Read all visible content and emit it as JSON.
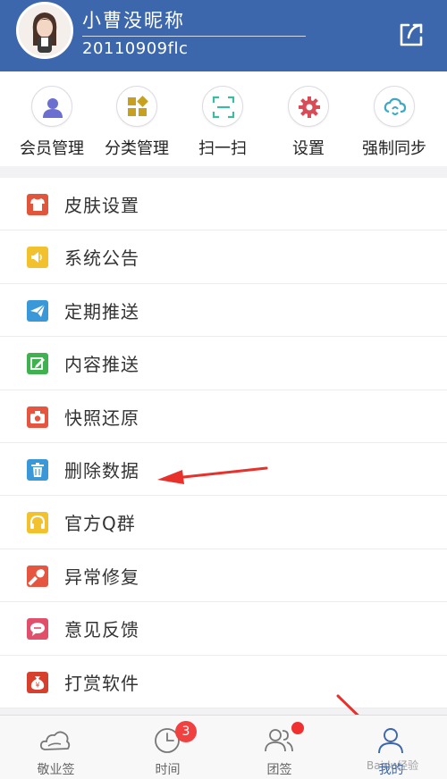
{
  "header": {
    "username": "小曹没昵称",
    "user_id": "20110909flc",
    "accent_color": "#3c67ad"
  },
  "quick_actions": [
    {
      "label": "会员管理",
      "icon": "member-icon"
    },
    {
      "label": "分类管理",
      "icon": "category-icon"
    },
    {
      "label": "扫一扫",
      "icon": "scan-icon"
    },
    {
      "label": "设置",
      "icon": "gear-icon"
    },
    {
      "label": "强制同步",
      "icon": "sync-icon"
    }
  ],
  "menu": [
    {
      "label": "皮肤设置",
      "icon": "shirt-icon",
      "color": "#e2553d"
    },
    {
      "label": "系统公告",
      "icon": "speaker-icon",
      "color": "#f2c12e"
    },
    {
      "label": "定期推送",
      "icon": "paper-plane-icon",
      "color": "#3a98d8"
    },
    {
      "label": "内容推送",
      "icon": "edit-icon",
      "color": "#3fb14e"
    },
    {
      "label": "快照还原",
      "icon": "camera-icon",
      "color": "#e5553f"
    },
    {
      "label": "删除数据",
      "icon": "trash-icon",
      "color": "#3a98d8"
    },
    {
      "label": "官方Q群",
      "icon": "headset-icon",
      "color": "#f2c12e"
    },
    {
      "label": "异常修复",
      "icon": "wrench-icon",
      "color": "#e5553f"
    },
    {
      "label": "意见反馈",
      "icon": "chat-icon",
      "color": "#e0506a"
    },
    {
      "label": "打赏软件",
      "icon": "money-bag-icon",
      "color": "#d8402e"
    }
  ],
  "tabs": [
    {
      "label": "敬业签",
      "icon": "cloud-icon",
      "active": false
    },
    {
      "label": "时间",
      "icon": "clock-icon",
      "active": false
    },
    {
      "label": "团签",
      "icon": "group-icon",
      "active": false
    },
    {
      "label": "我的",
      "icon": "user-icon",
      "active": true
    }
  ],
  "badges": {
    "time_count": "3"
  },
  "watermark": "Baidu经验"
}
